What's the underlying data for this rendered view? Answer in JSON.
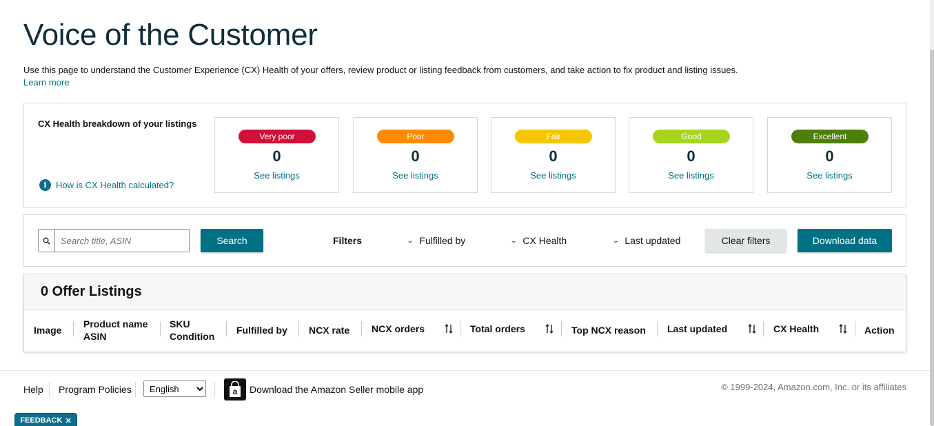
{
  "page": {
    "title": "Voice of the Customer",
    "intro": "Use this page to understand the Customer Experience (CX) Health of your offers, review product or listing feedback from customers, and take action to fix product and listing issues.",
    "learn_more": "Learn more"
  },
  "cx_health": {
    "title": "CX Health breakdown of your listings",
    "help_link": "How is CX Health calculated?",
    "cards": [
      {
        "label": "Very poor",
        "count": "0",
        "link": "See listings",
        "color": "#d0103a"
      },
      {
        "label": "Poor",
        "count": "0",
        "link": "See listings",
        "color": "#ff8c00"
      },
      {
        "label": "Fair",
        "count": "0",
        "link": "See listings",
        "color": "#f7c600"
      },
      {
        "label": "Good",
        "count": "0",
        "link": "See listings",
        "color": "#a5d61d"
      },
      {
        "label": "Excellent",
        "count": "0",
        "link": "See listings",
        "color": "#4e7f0a"
      }
    ]
  },
  "filters": {
    "search_placeholder": "Search title, ASIN",
    "search_button": "Search",
    "filters_label": "Filters",
    "fulfilled_by": "Fulfilled by",
    "cx_health": "CX Health",
    "last_updated": "Last updated",
    "clear_button": "Clear filters",
    "download_button": "Download data"
  },
  "listings": {
    "title": "0 Offer Listings",
    "columns": {
      "image": "Image",
      "product_name": "Product name",
      "asin": "ASIN",
      "sku": "SKU",
      "condition": "Condition",
      "fulfilled_by": "Fulfilled by",
      "ncx_rate": "NCX rate",
      "ncx_orders": "NCX orders",
      "total_orders": "Total orders",
      "top_ncx_reason": "Top NCX reason",
      "last_updated": "Last updated",
      "cx_health": "CX Health",
      "action": "Action"
    }
  },
  "footer": {
    "help": "Help",
    "program_policies": "Program Policies",
    "language": "English",
    "app_text": "Download the Amazon Seller mobile app",
    "copyright": "© 1999-2024, Amazon.com, Inc. or its affiliates",
    "feedback": "FEEDBACK"
  },
  "colors": {
    "accent": "#007185",
    "link": "#007185"
  }
}
